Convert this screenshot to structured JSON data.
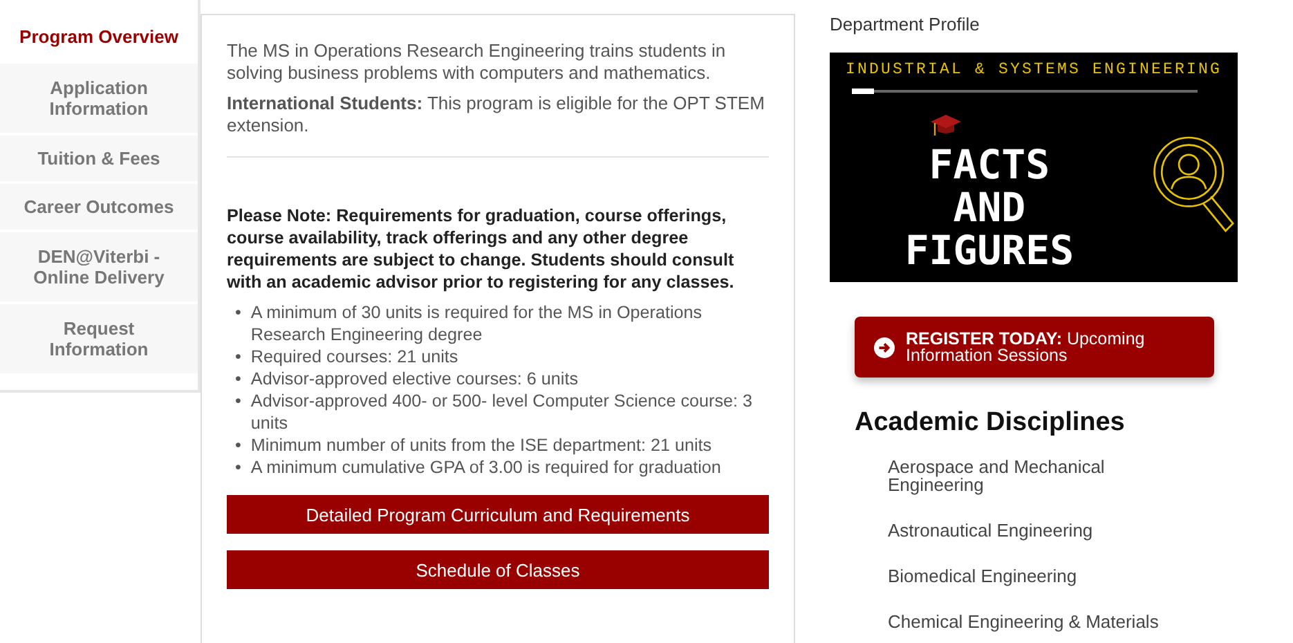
{
  "tabs": [
    {
      "label": "Program Overview",
      "selected": true
    },
    {
      "label": "Application Information",
      "selected": false
    },
    {
      "label": "Tuition & Fees",
      "selected": false
    },
    {
      "label": "Career Outcomes",
      "selected": false
    },
    {
      "label": "DEN@Viterbi - Online Delivery",
      "selected": false
    },
    {
      "label": "Request Information",
      "selected": false
    }
  ],
  "overview": {
    "intro": "The MS in Operations Research Engineering trains students in solving business problems with computers and mathematics.",
    "international": "**International Students:** This program is eligible for the OPT STEM extension.",
    "note": "Please Note: Requirements for graduation, course offerings, course availability, track offerings and any other degree requirements are subject to change. Students should consult with an academic advisor prior to registering for any classes.",
    "requirements": [
      {
        "marker": "•",
        "text": "A minimum of 30 units is required for the MS in Operations Research Engineering degree"
      },
      {
        "marker": "•",
        "text": "Required courses: 21 units"
      },
      {
        "marker": "•",
        "text": "Advisor-approved elective courses: 6 units"
      },
      {
        "marker": "•",
        "text": "Advisor-approved 400- or 500- level Computer Science course: 3 units"
      },
      {
        "marker": "•",
        "text": "Minimum number of units from the ISE department: 21 units"
      },
      {
        "marker": "•",
        "text": "A minimum cumulative GPA of 3.00 is required for graduation"
      }
    ],
    "buttons": [
      "Detailed Program Curriculum and Requirements",
      "Schedule of Classes"
    ]
  },
  "sidebar": {
    "profile_heading": "Department Profile",
    "banner": {
      "department": "INDUSTRIAL & SYSTEMS ENGINEERING",
      "title": "FACTS AND FIGURES"
    },
    "register": "**REGISTER TODAY:** Upcoming Information Sessions",
    "disciplines_heading": "Academic Disciplines",
    "disciplines": [
      "Aerospace and Mechanical Engineering",
      "Astronautical Engineering",
      "Biomedical Engineering",
      "Chemical Engineering & Materials"
    ]
  }
}
